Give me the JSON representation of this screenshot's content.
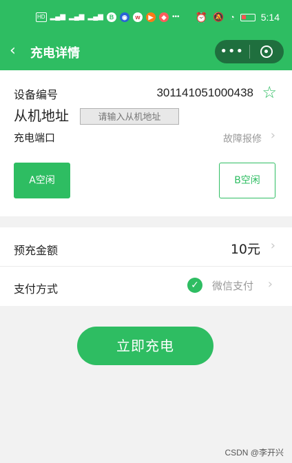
{
  "statusbar": {
    "left_icons": [
      "HD",
      "4G",
      "signal",
      "4G",
      "signal",
      "signal",
      "B",
      "baidu",
      "w",
      "play",
      "nav",
      "more"
    ],
    "right_icons": [
      "alarm-icon",
      "mute-icon",
      "wifi-icon"
    ],
    "time": "5:14"
  },
  "navbar": {
    "back_icon": "chevron-left-icon",
    "title": "充电详情",
    "more_icon": "ellipsis-icon",
    "close_icon": "target-icon"
  },
  "device": {
    "label": "设备编号",
    "number": "301141051000438",
    "favorite_icon": "star-outline-icon"
  },
  "slave": {
    "label": "从机地址",
    "placeholder": "请输入从机地址"
  },
  "port": {
    "label": "充电端口",
    "fault_link": "故障报修",
    "options": [
      {
        "label": "A空闲",
        "selected": true
      },
      {
        "label": "B空闲",
        "selected": false
      }
    ]
  },
  "prepay": {
    "label": "预充金额",
    "amount": "10元"
  },
  "payment": {
    "label": "支付方式",
    "method": "微信支付",
    "icon": "wechat-check-icon"
  },
  "actions": {
    "charge_label": "立即充电"
  },
  "watermark": "CSDN @李开兴",
  "colors": {
    "brand": "#2ebd62",
    "capsule": "#1f6f3e",
    "muted": "#999999"
  }
}
